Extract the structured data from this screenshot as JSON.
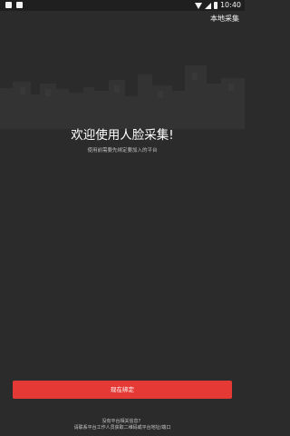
{
  "status_bar": {
    "time": "10:40",
    "left_icons": [
      "notification-icon",
      "notification-icon"
    ],
    "right_icons": [
      "wifi-icon",
      "signal-icon",
      "battery-icon"
    ]
  },
  "topbar": {
    "action_label": "本地采集"
  },
  "main": {
    "headline": "欢迎使用人脸采集!",
    "subtitle": "使用前需要先绑定要加入的平台"
  },
  "bind_button": {
    "label": "现在绑定",
    "color": "#e53935"
  },
  "footer": {
    "question": "没有平台相关信息？",
    "hint": "请联系平台工作人员获取二维码或平台地址/端口"
  },
  "colors": {
    "background": "#2b2b2b",
    "status_bar": "#1f1f1f",
    "skyline": "#333333"
  }
}
